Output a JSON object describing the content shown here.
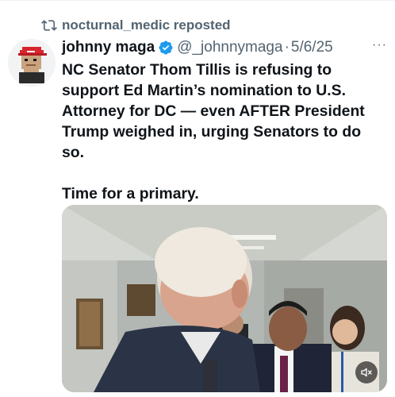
{
  "repost": {
    "icon": "repost-icon",
    "text": "nocturnal_medic reposted"
  },
  "author": {
    "display_name": "johnny maga",
    "verified_icon": "verified-badge-icon",
    "handle": "@_johnnymaga",
    "separator": "·",
    "date": "5/6/25",
    "more_label": "···"
  },
  "tweet": {
    "paragraphs": [
      "NC Senator Thom Tillis is refusing to support Ed Martin’s nomination to U.S. Attorney for DC — even AFTER President Trump weighed in, urging Senators to do so.",
      "Time for a primary."
    ]
  },
  "media": {
    "type": "video",
    "mute_icon": "volume-muted-icon"
  },
  "colors": {
    "text": "#0f1419",
    "secondary": "#536471",
    "verified": "#1d9bf0",
    "avatar_hat": "#d8262f"
  }
}
